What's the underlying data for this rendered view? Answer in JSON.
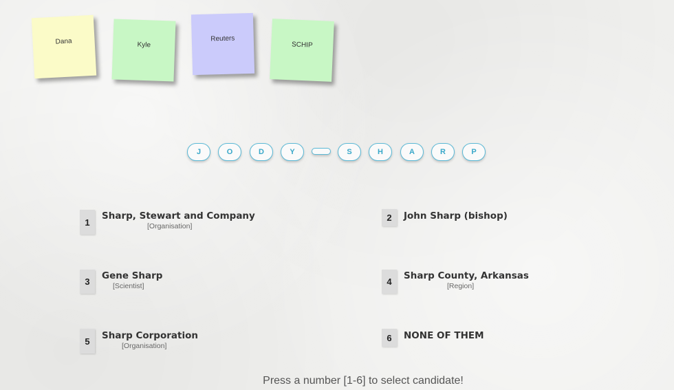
{
  "notes": [
    {
      "label": "Dana",
      "color": "#fbfbc8"
    },
    {
      "label": "Kyle",
      "color": "#c8f7c5"
    },
    {
      "label": "Reuters",
      "color": "#cbcbfb"
    },
    {
      "label": "SCHIP",
      "color": "#c8f7c5"
    }
  ],
  "letters": [
    "J",
    "O",
    "D",
    "Y",
    "",
    "S",
    "H",
    "A",
    "R",
    "P"
  ],
  "candidates": [
    {
      "number": "1",
      "name": "Sharp, Stewart and Company",
      "type": "[Organisation]"
    },
    {
      "number": "2",
      "name": "John Sharp (bishop)",
      "type": ""
    },
    {
      "number": "3",
      "name": "Gene Sharp",
      "type": "[Scientist]"
    },
    {
      "number": "4",
      "name": "Sharp County, Arkansas",
      "type": "[Region]"
    },
    {
      "number": "5",
      "name": "Sharp Corporation",
      "type": "[Organisation]"
    },
    {
      "number": "6",
      "name": "NONE OF THEM",
      "type": ""
    }
  ],
  "footer": "Press a number [1-6] to select candidate!"
}
